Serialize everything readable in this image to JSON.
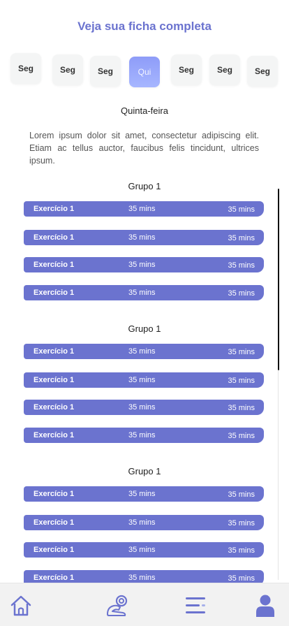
{
  "header": {
    "title": "Veja sua ficha completa"
  },
  "days": [
    {
      "label": "Seg",
      "active": false
    },
    {
      "label": "Seg",
      "active": false
    },
    {
      "label": "Seg",
      "active": false
    },
    {
      "label": "Qui",
      "active": true
    },
    {
      "label": "Seg",
      "active": false
    },
    {
      "label": "Seg",
      "active": false
    },
    {
      "label": "Seg",
      "active": false
    }
  ],
  "day_detail": {
    "name": "Quinta-feira",
    "description": "Lorem ipsum dolor sit amet, consectetur adipiscing elit. Etiam ac tellus auctor, faucibus felis tincidunt, ultrices ipsum."
  },
  "groups": [
    {
      "title": "Grupo 1",
      "exercises": [
        {
          "name": "Exercício 1",
          "duration": "35 mins",
          "time": "35 mins"
        },
        {
          "name": "Exercício 1",
          "duration": "35 mins",
          "time": "35 mins"
        },
        {
          "name": "Exercício 1",
          "duration": "35 mins",
          "time": "35 mins"
        },
        {
          "name": "Exercício 1",
          "duration": "35 mins",
          "time": "35 mins"
        }
      ]
    },
    {
      "title": "Grupo 1",
      "exercises": [
        {
          "name": "Exercício 1",
          "duration": "35 mins",
          "time": "35 mins"
        },
        {
          "name": "Exercício 1",
          "duration": "35 mins",
          "time": "35 mins"
        },
        {
          "name": "Exercício 1",
          "duration": "35 mins",
          "time": "35 mins"
        },
        {
          "name": "Exercício 1",
          "duration": "35 mins",
          "time": "35 mins"
        }
      ]
    },
    {
      "title": "Grupo 1",
      "exercises": [
        {
          "name": "Exercício 1",
          "duration": "35 mins",
          "time": "35 mins"
        },
        {
          "name": "Exercício 1",
          "duration": "35 mins",
          "time": "35 mins"
        },
        {
          "name": "Exercício 1",
          "duration": "35 mins",
          "time": "35 mins"
        },
        {
          "name": "Exercício 1",
          "duration": "35 mins",
          "time": "35 mins"
        }
      ]
    }
  ],
  "navbar": {
    "items": [
      "home-icon",
      "dumbbell-arm-icon",
      "menu-lines-icon",
      "user-icon"
    ],
    "color": "#6b73cf"
  },
  "colors": {
    "accent": "#6b73cf",
    "active_day": "#9aa9fb"
  }
}
